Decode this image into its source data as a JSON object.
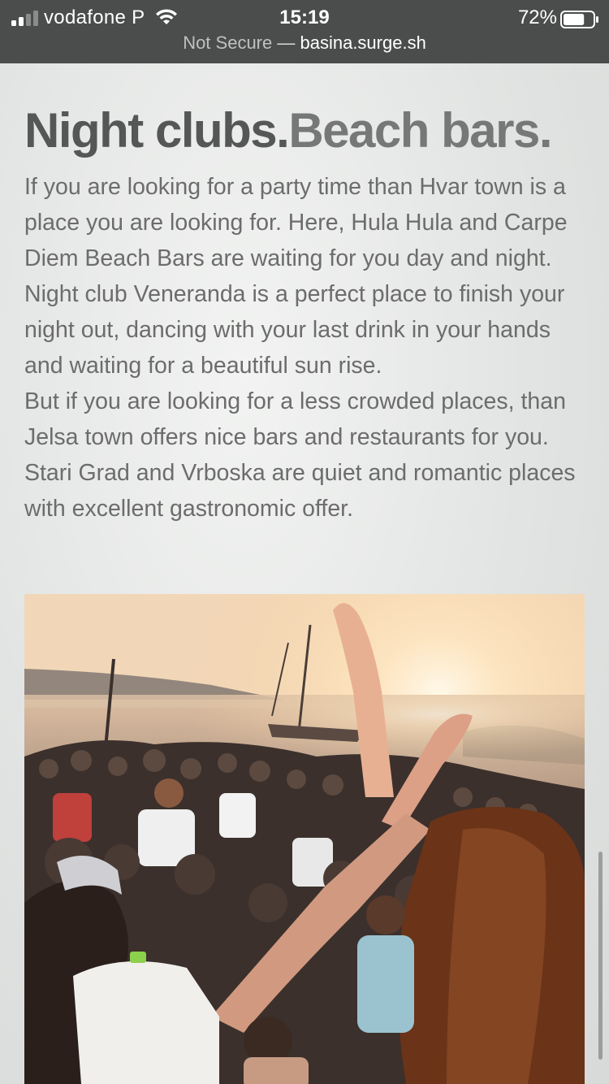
{
  "status_bar": {
    "carrier": "vodafone P",
    "time": "15:19",
    "battery_percent": "72%",
    "battery_level": 0.72,
    "signal_bars": 2,
    "signal_bars_total": 4
  },
  "browser": {
    "security_label": "Not Secure",
    "separator": " — ",
    "host": "basina.surge.sh"
  },
  "article": {
    "title_part1": "Night clubs.",
    "title_part2": "Beach bars.",
    "paragraph1": "If you are looking for a party time than Hvar town is a place you are looking for. Here, Hula Hula and Carpe Diem Beach Bars are waiting for you day and night. Night club Veneranda is a perfect place to finish your night out, dancing with your last drink in your hands and waiting for a beautiful sun rise.",
    "paragraph2": "But if you are looking for a less crowded places, than Jelsa town offers nice bars and restaurants for you. Stari Grad and Vrboska are quiet and romantic places with excellent gastronomic offer."
  },
  "photo": {
    "subject": "beach-party-crowd-at-sunset"
  },
  "colors": {
    "status_bar_bg": "#4b4d4c",
    "title": "#555656",
    "title_accent": "#767777",
    "body_text": "#6b6c6b",
    "sunset": "#f6cfa0"
  }
}
